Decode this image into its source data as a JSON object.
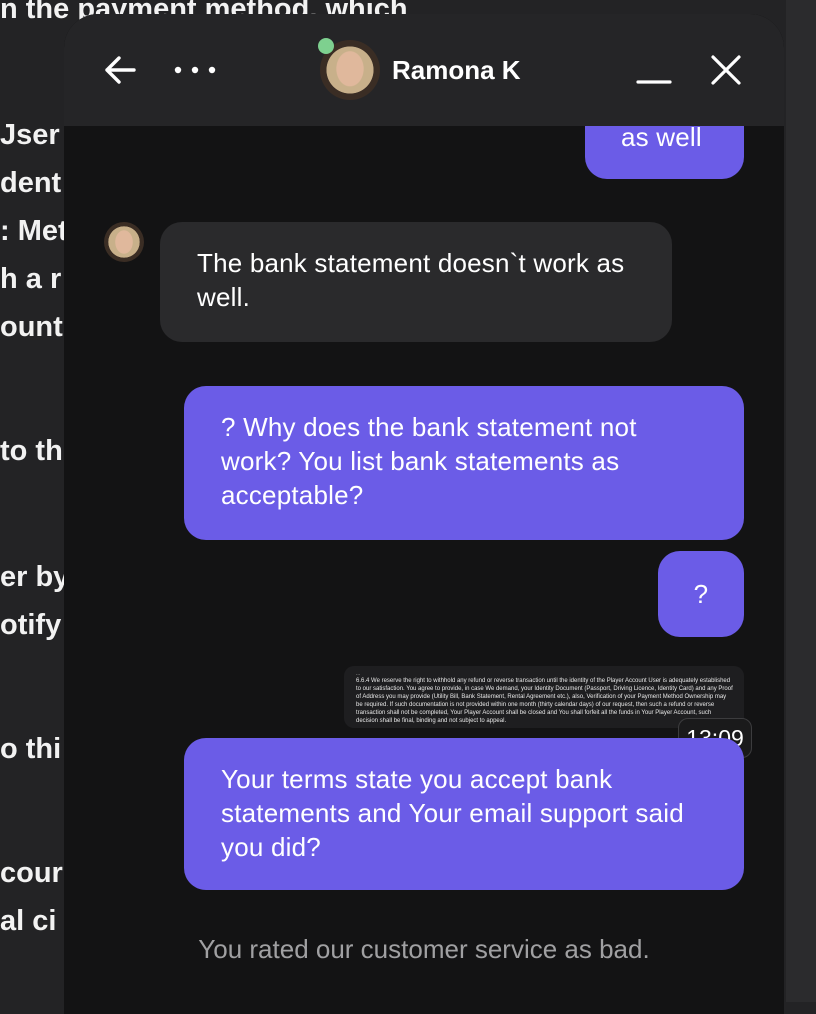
{
  "background_page": {
    "lines": [
      "n the payment method, which",
      "Jser",
      "dent",
      ": Met",
      "h a r",
      "ount",
      "to th",
      "er by",
      "otify",
      "o thi",
      "cour",
      "al ci"
    ]
  },
  "header": {
    "agent_name": "Ramona K",
    "icons": [
      "back-arrow-icon",
      "more-dots-icon",
      "minimize-icon",
      "close-icon"
    ],
    "online_status_color": "#7ed08f"
  },
  "messages": [
    {
      "sender": "user",
      "text": "as well"
    },
    {
      "sender": "agent",
      "text": "The bank statement doesn`t work as well."
    },
    {
      "sender": "user",
      "text": "? Why does the bank statement not work? You list bank statements as acceptable?"
    },
    {
      "sender": "user",
      "text": "?"
    },
    {
      "sender": "user",
      "attachment": {
        "top_text": "...",
        "body_text": "6.6.4 We reserve the right to withhold any refund or reverse transaction until the identity of the Player Account User is adequately established to our satisfaction. You agree to provide, in case We demand, your Identity Document (Passport, Driving Licence, Identity Card) and any Proof of Address you may provide (Utility Bill, Bank Statement, Rental Agreement etc.), also, Verification of your Payment Method Ownership may be required. If such documentation is not provided within one month (thirty calendar days) of our request, then such a refund or reverse transaction shall not be completed, Your Player Account shall be closed and You shall forfeit all the funds in Your Player Account, such decision shall be final, binding and not subject to appeal.",
        "time": "13:09"
      }
    },
    {
      "sender": "user",
      "text": "Your terms state you accept bank statements and Your email support said you did?"
    }
  ],
  "footer": {
    "rating_note": "You rated our customer service as bad."
  },
  "colors": {
    "user_bubble": "#6b5ce7",
    "agent_bubble": "#2a2a2c",
    "chat_background": "#131314",
    "header_background": "#252527"
  }
}
